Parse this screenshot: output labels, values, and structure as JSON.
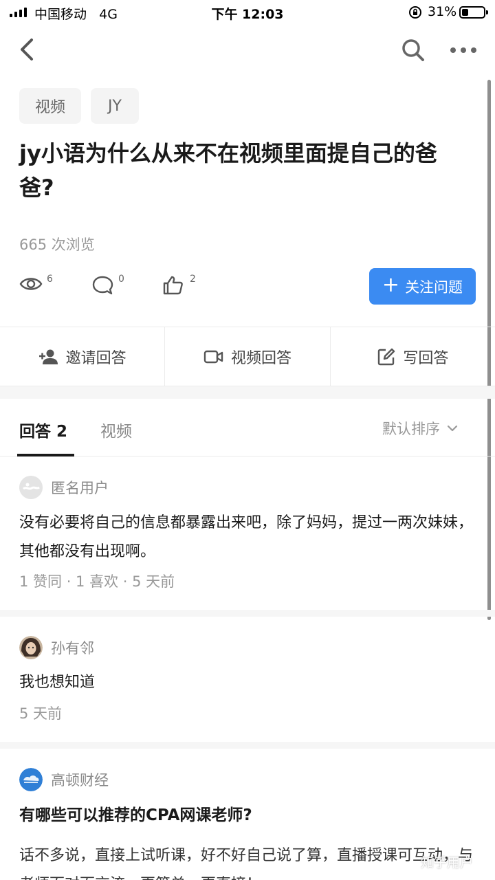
{
  "status_bar": {
    "carrier": "中国移动",
    "network": "4G",
    "time": "下午 12:03",
    "battery_percent": "31%",
    "battery_level": 0.31
  },
  "nav": {
    "back_icon": "chevron-left-icon",
    "search_icon": "search-icon",
    "more_icon": "more-dots-icon"
  },
  "question": {
    "tags": [
      "视频",
      "JY"
    ],
    "title": "jy小语为什么从来不在视频里面提自己的爸爸?",
    "views_line": "665 次浏览",
    "stats": {
      "views": "6",
      "comments": "0",
      "likes": "2"
    },
    "follow_label": "关注问题"
  },
  "actions": {
    "invite": "邀请回答",
    "video": "视频回答",
    "write": "写回答"
  },
  "tabs": {
    "answers": "回答 2",
    "video": "视频",
    "sort": "默认排序"
  },
  "answers": [
    {
      "author": "匿名用户",
      "text": "没有必要将自己的信息都暴露出来吧，除了妈妈，提过一两次妹妹，其他都没有出现啊。",
      "meta": "1 赞同 · 1 喜欢 · 5 天前"
    },
    {
      "author": "孙有邻",
      "text": "我也想知道",
      "meta": "5 天前"
    }
  ],
  "recommendation": {
    "author": "高顿财经",
    "title": "有哪些可以推荐的CPA网课老师?",
    "body": "话不多说，直接上试听课，好不好自己说了算，直播授课可互动，与老师面对面交流，更简单，更直接！",
    "logo_text": "高顿财经"
  },
  "watermark": "知乎用户",
  "colors": {
    "accent": "#3b8bf2",
    "text": "#1a1a1a",
    "muted": "#999999",
    "logo": "#2f7fd6"
  }
}
